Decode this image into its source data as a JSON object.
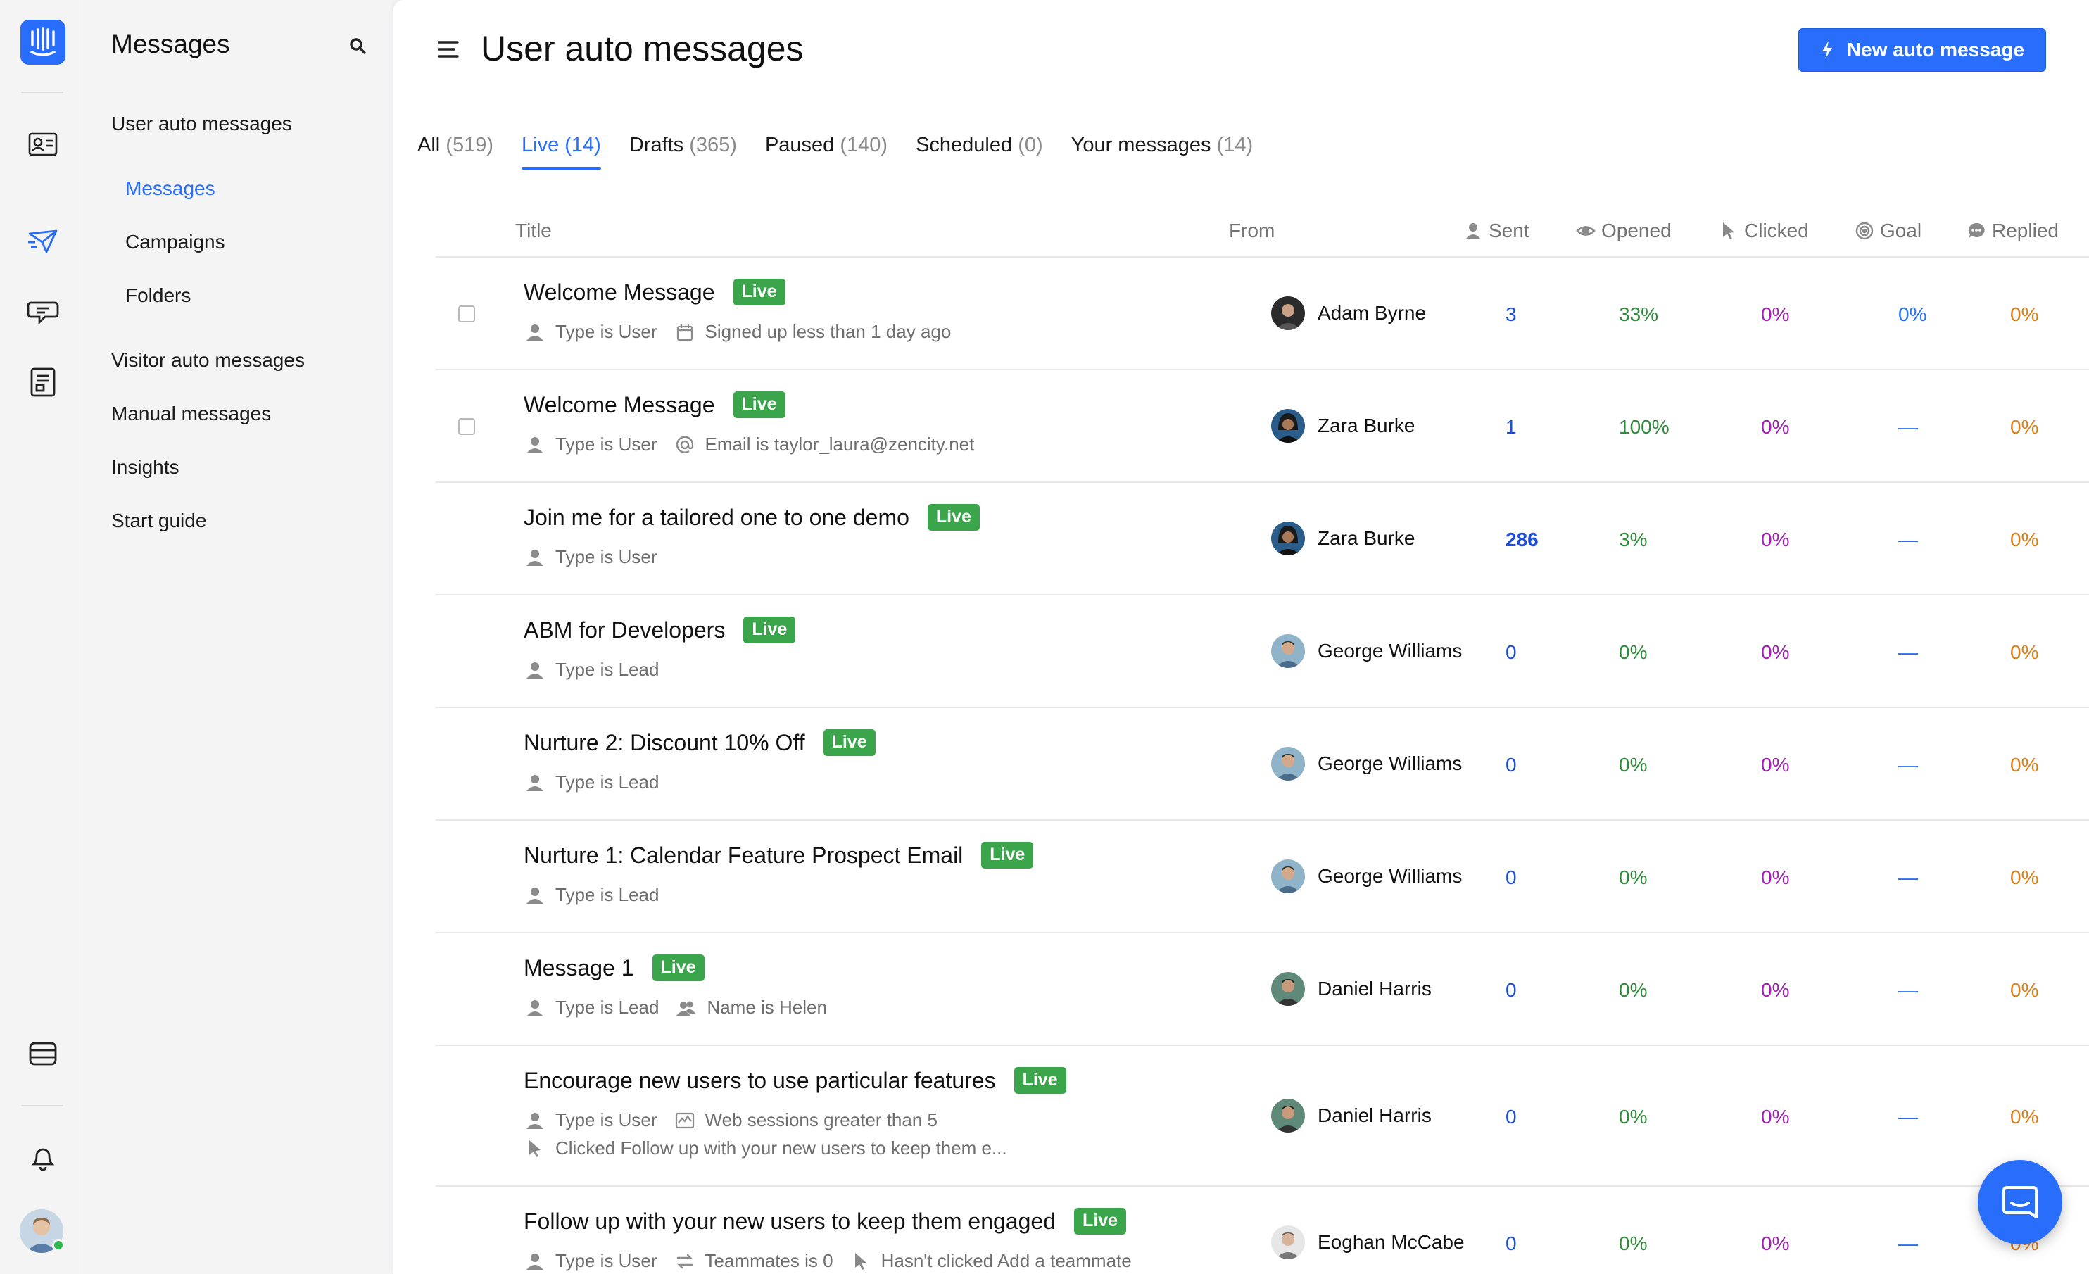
{
  "colors": {
    "accent": "#286efa",
    "live_badge": "#3aa54b",
    "sent": "#1d4fd6",
    "opened": "#2e8b3a",
    "clicked": "#a11fb2",
    "replied": "#e07b12"
  },
  "rail": {
    "icons": [
      "intercom-logo",
      "contacts-icon",
      "outbound-icon",
      "inbox-icon",
      "articles-icon",
      "apps-icon",
      "notifications-icon",
      "profile-avatar"
    ]
  },
  "nav": {
    "title": "Messages",
    "section_user": "User auto messages",
    "sub_messages": "Messages",
    "sub_campaigns": "Campaigns",
    "sub_folders": "Folders",
    "visitor": "Visitor auto messages",
    "manual": "Manual messages",
    "insights": "Insights",
    "start_guide": "Start guide"
  },
  "header": {
    "title": "User auto messages",
    "new_button": "New auto message"
  },
  "tabs": [
    {
      "label": "All",
      "count": "(519)"
    },
    {
      "label": "Live",
      "count": "(14)"
    },
    {
      "label": "Drafts",
      "count": "(365)"
    },
    {
      "label": "Paused",
      "count": "(140)"
    },
    {
      "label": "Scheduled",
      "count": "(0)"
    },
    {
      "label": "Your messages",
      "count": "(14)"
    }
  ],
  "columns": {
    "title": "Title",
    "from": "From",
    "sent": "Sent",
    "opened": "Opened",
    "clicked": "Clicked",
    "goal": "Goal",
    "replied": "Replied"
  },
  "rows": [
    {
      "title": "Welcome Message",
      "badge": "Live",
      "meta1": "Type is User",
      "meta2": "Signed up less than 1 day ago",
      "from": "Adam Byrne",
      "sent": "3",
      "opened": "33%",
      "clicked": "0%",
      "goal": "0%",
      "replied": "0%"
    },
    {
      "title": "Welcome Message",
      "badge": "Live",
      "meta1": "Type is User",
      "meta2": "Email is taylor_laura@zencity.net",
      "from": "Zara Burke",
      "sent": "1",
      "opened": "100%",
      "clicked": "0%",
      "goal": "—",
      "replied": "0%"
    },
    {
      "title": "Join me for a tailored one to one demo",
      "badge": "Live",
      "meta1": "Type is User",
      "from": "Zara Burke",
      "sent": "286",
      "opened": "3%",
      "clicked": "0%",
      "goal": "—",
      "replied": "0%"
    },
    {
      "title": "ABM for Developers",
      "badge": "Live",
      "meta1": "Type is Lead",
      "from": "George Williams",
      "sent": "0",
      "opened": "0%",
      "clicked": "0%",
      "goal": "—",
      "replied": "0%"
    },
    {
      "title": "Nurture 2: Discount 10% Off",
      "badge": "Live",
      "meta1": "Type is Lead",
      "from": "George Williams",
      "sent": "0",
      "opened": "0%",
      "clicked": "0%",
      "goal": "—",
      "replied": "0%"
    },
    {
      "title": "Nurture 1: Calendar Feature Prospect Email",
      "badge": "Live",
      "meta1": "Type is Lead",
      "from": "George Williams",
      "sent": "0",
      "opened": "0%",
      "clicked": "0%",
      "goal": "—",
      "replied": "0%"
    },
    {
      "title": "Message 1",
      "badge": "Live",
      "meta1": "Type is Lead",
      "meta2": "Name is Helen",
      "from": "Daniel Harris",
      "sent": "0",
      "opened": "0%",
      "clicked": "0%",
      "goal": "—",
      "replied": "0%"
    },
    {
      "title": "Encourage new users to use particular features",
      "badge": "Live",
      "meta1": "Type is User",
      "meta2": "Web sessions greater than 5",
      "meta3": "Clicked Follow up with your new users to keep them e...",
      "from": "Daniel Harris",
      "sent": "0",
      "opened": "0%",
      "clicked": "0%",
      "goal": "—",
      "replied": "0%"
    },
    {
      "title": "Follow up with your new users to keep them engaged",
      "badge": "Live",
      "meta1": "Type is User",
      "meta2": "Teammates is 0",
      "meta3": "Hasn't clicked Add a teammate",
      "from": "Eoghan McCabe",
      "sent": "0",
      "opened": "0%",
      "clicked": "0%",
      "goal": "—",
      "replied": "0%"
    }
  ]
}
